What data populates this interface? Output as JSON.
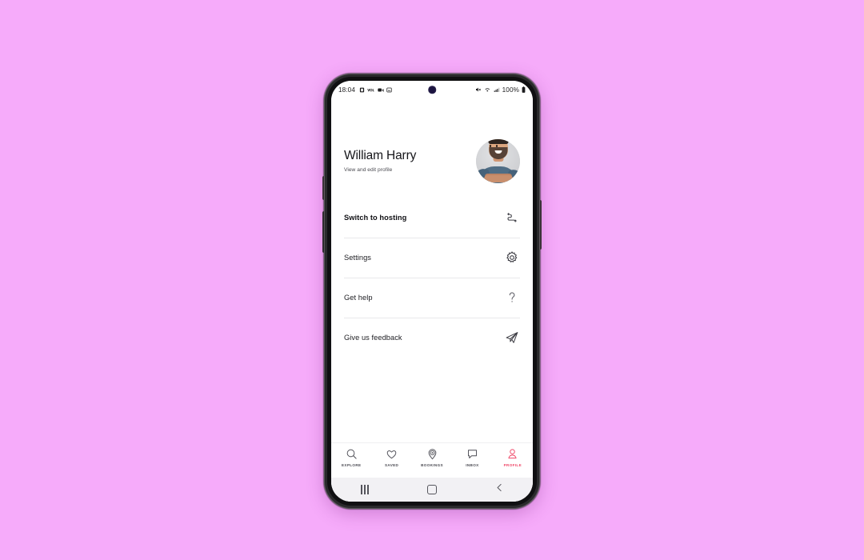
{
  "background": {
    "color": "#f6abfa"
  },
  "device": {
    "frame_color": "#2a2a2c",
    "screen_color": "#ffffff"
  },
  "status_bar": {
    "clock": "18:04",
    "battery_percent": "100%",
    "left_icons": [
      "sim-card-icon",
      "vo-lte-icon",
      "video-camera-icon",
      "screenshot-icon"
    ],
    "right_icons": [
      "volume-mute-icon",
      "wifi-icon",
      "cellular-signal-icon",
      "battery-icon"
    ]
  },
  "profile": {
    "name": "William Harry",
    "subtitle": "View and edit profile",
    "avatar_name": "user-avatar-photo"
  },
  "menu": {
    "items": [
      {
        "label": "Switch to hosting",
        "icon": "switch-arrows-icon",
        "bold": true
      },
      {
        "label": "Settings",
        "icon": "gear-icon",
        "bold": false
      },
      {
        "label": "Get help",
        "icon": "question-mark-icon",
        "bold": false
      },
      {
        "label": "Give us feedback",
        "icon": "paper-plane-icon",
        "bold": false
      }
    ]
  },
  "tab_bar": {
    "active_color": "#ef4667",
    "inactive_color": "#4c4c54",
    "tabs": [
      {
        "label": "EXPLORE",
        "icon": "search-icon",
        "active": false
      },
      {
        "label": "SAVED",
        "icon": "heart-icon",
        "active": false
      },
      {
        "label": "BOOKINGS",
        "icon": "map-pin-icon",
        "active": false
      },
      {
        "label": "INBOX",
        "icon": "chat-bubble-icon",
        "active": false
      },
      {
        "label": "PROFILE",
        "icon": "person-icon",
        "active": true
      }
    ]
  },
  "android_nav": {
    "buttons": [
      {
        "name": "recents-button",
        "icon": "three-bars-icon"
      },
      {
        "name": "home-button",
        "icon": "square-icon"
      },
      {
        "name": "back-button",
        "icon": "chevron-left-icon"
      }
    ]
  }
}
